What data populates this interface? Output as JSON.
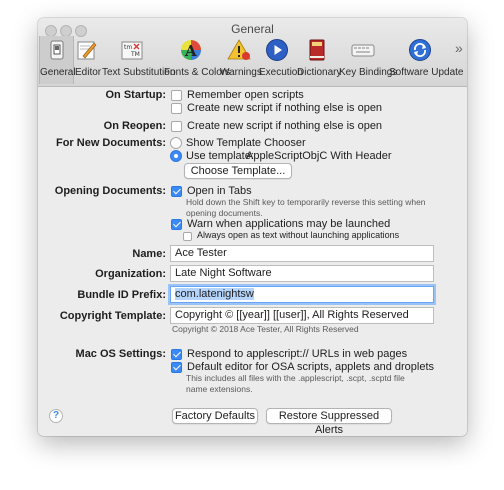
{
  "window": {
    "title": "General"
  },
  "toolbar": {
    "items": [
      {
        "label": "General",
        "icon": "switch-icon",
        "selected": true
      },
      {
        "label": "Editor",
        "icon": "pencil-icon"
      },
      {
        "label": "Text Substitution",
        "icon": "text-substitution-icon"
      },
      {
        "label": "Fonts & Colors",
        "icon": "fonts-colors-icon"
      },
      {
        "label": "Warnings",
        "icon": "warning-icon"
      },
      {
        "label": "Execution",
        "icon": "play-icon"
      },
      {
        "label": "Dictionary",
        "icon": "dictionary-icon"
      },
      {
        "label": "Key Bindings",
        "icon": "keyboard-icon"
      },
      {
        "label": "Software Update",
        "icon": "software-update-icon"
      }
    ],
    "overflow": "»"
  },
  "startup": {
    "label": "On Startup:",
    "remember_open": {
      "text": "Remember open scripts",
      "checked": false
    },
    "new_script": {
      "text": "Create new script if nothing else is open",
      "checked": false
    }
  },
  "reopen": {
    "label": "On Reopen:",
    "new_script": {
      "text": "Create new script if nothing else is open",
      "checked": false
    }
  },
  "new_documents": {
    "label": "For New Documents:",
    "show_chooser": {
      "text": "Show Template Chooser",
      "selected": false
    },
    "use_template": {
      "text": "Use template:",
      "value": "AppleScriptObjC With Header",
      "selected": true
    },
    "choose_button": "Choose Template..."
  },
  "opening": {
    "label": "Opening Documents:",
    "open_in_tabs": {
      "text": "Open in Tabs",
      "checked": true,
      "note": "Hold down the Shift key to temporarily reverse this setting when opening documents."
    },
    "warn_apps": {
      "text": "Warn when applications may be launched",
      "checked": true
    },
    "always_text": {
      "text": "Always open as text without launching applications",
      "checked": false
    }
  },
  "name": {
    "label": "Name:",
    "value": "Ace Tester"
  },
  "organization": {
    "label": "Organization:",
    "value": "Late Night Software"
  },
  "bundle": {
    "label": "Bundle ID Prefix:",
    "value": "com.latenightsw"
  },
  "copyright": {
    "label": "Copyright Template:",
    "value": "Copyright © [[year]] [[user]], All Rights Reserved",
    "preview": "Copyright © 2018 Ace Tester, All Rights Reserved"
  },
  "macos": {
    "label": "Mac OS Settings:",
    "respond": {
      "text": "Respond to applescript:// URLs in web pages",
      "checked": true
    },
    "default_editor": {
      "text": "Default editor for OSA scripts, applets and droplets",
      "checked": true,
      "note": "This includes all files with the .applescript, .scpt, .scptd file name extensions."
    }
  },
  "footer": {
    "help": "?",
    "factory": "Factory Defaults",
    "restore": "Restore Suppressed Alerts"
  },
  "colors": {
    "accent": "#3b8af7",
    "window_bg": "#ececec"
  }
}
